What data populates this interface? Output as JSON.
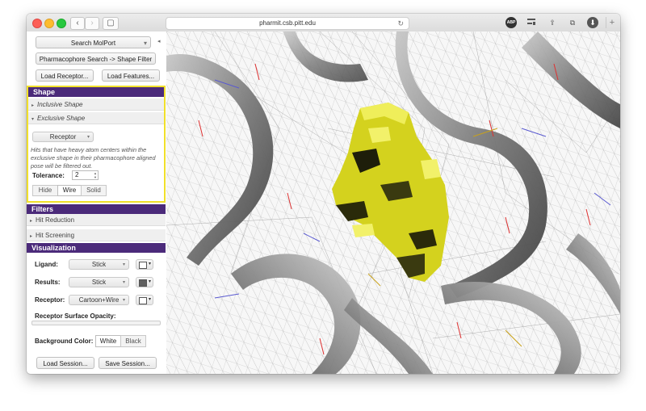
{
  "browser": {
    "url": "pharmit.csb.pitt.edu",
    "tab_glyph": "▢",
    "back_glyph": "‹",
    "forward_glyph": "›",
    "reload_glyph": "↻",
    "adblock_text": "ABP",
    "share_glyph": "⇪",
    "tabs_glyph": "⧉",
    "download_glyph": "⬇",
    "new_tab_glyph": "+"
  },
  "sidebar": {
    "collapse_glyph": "◂",
    "search_molport": "Search MolPort",
    "search_dropdown_caret": "▾",
    "pharma_to_shape": "Pharmacophore Search -> Shape Filter",
    "load_receptor": "Load Receptor...",
    "load_features": "Load Features...",
    "shape": {
      "header": "Shape",
      "inclusive_label": "Inclusive Shape",
      "inclusive_arrow": "▸",
      "exclusive_label": "Exclusive Shape",
      "exclusive_arrow": "▾",
      "receptor_button": "Receptor",
      "description": "Hits that have heavy atom centers within the exclusive shape in their pharmacophore aligned pose will be filtered out.",
      "tolerance_label": "Tolerance:",
      "tolerance_value": "2",
      "display_modes": [
        "Hide",
        "Wire",
        "Solid"
      ],
      "selected_mode": "Wire"
    },
    "filters": {
      "header": "Filters",
      "hit_reduction": "Hit Reduction",
      "hit_screening": "Hit Screening",
      "arrow": "▸"
    },
    "visualization": {
      "header": "Visualization",
      "ligand_label": "Ligand:",
      "ligand_style": "Stick",
      "ligand_color": "#ffffff",
      "results_label": "Results:",
      "results_style": "Stick",
      "results_color": "#606060",
      "receptor_label": "Receptor:",
      "receptor_style": "Cartoon+Wire",
      "receptor_color": "#ffffff",
      "surface_opacity_label": "Receptor Surface Opacity:",
      "surface_opacity": 0.0,
      "background_label": "Background Color:",
      "background_options": [
        "White",
        "Black"
      ],
      "background_selected": "White"
    },
    "load_session": "Load Session...",
    "save_session": "Save Session..."
  },
  "colors": {
    "section_header": "#4b2a7a",
    "shape_highlight": "#f1e02a",
    "shape_yellow": "#d4d21e",
    "ribbon": "#8a8a8a"
  }
}
